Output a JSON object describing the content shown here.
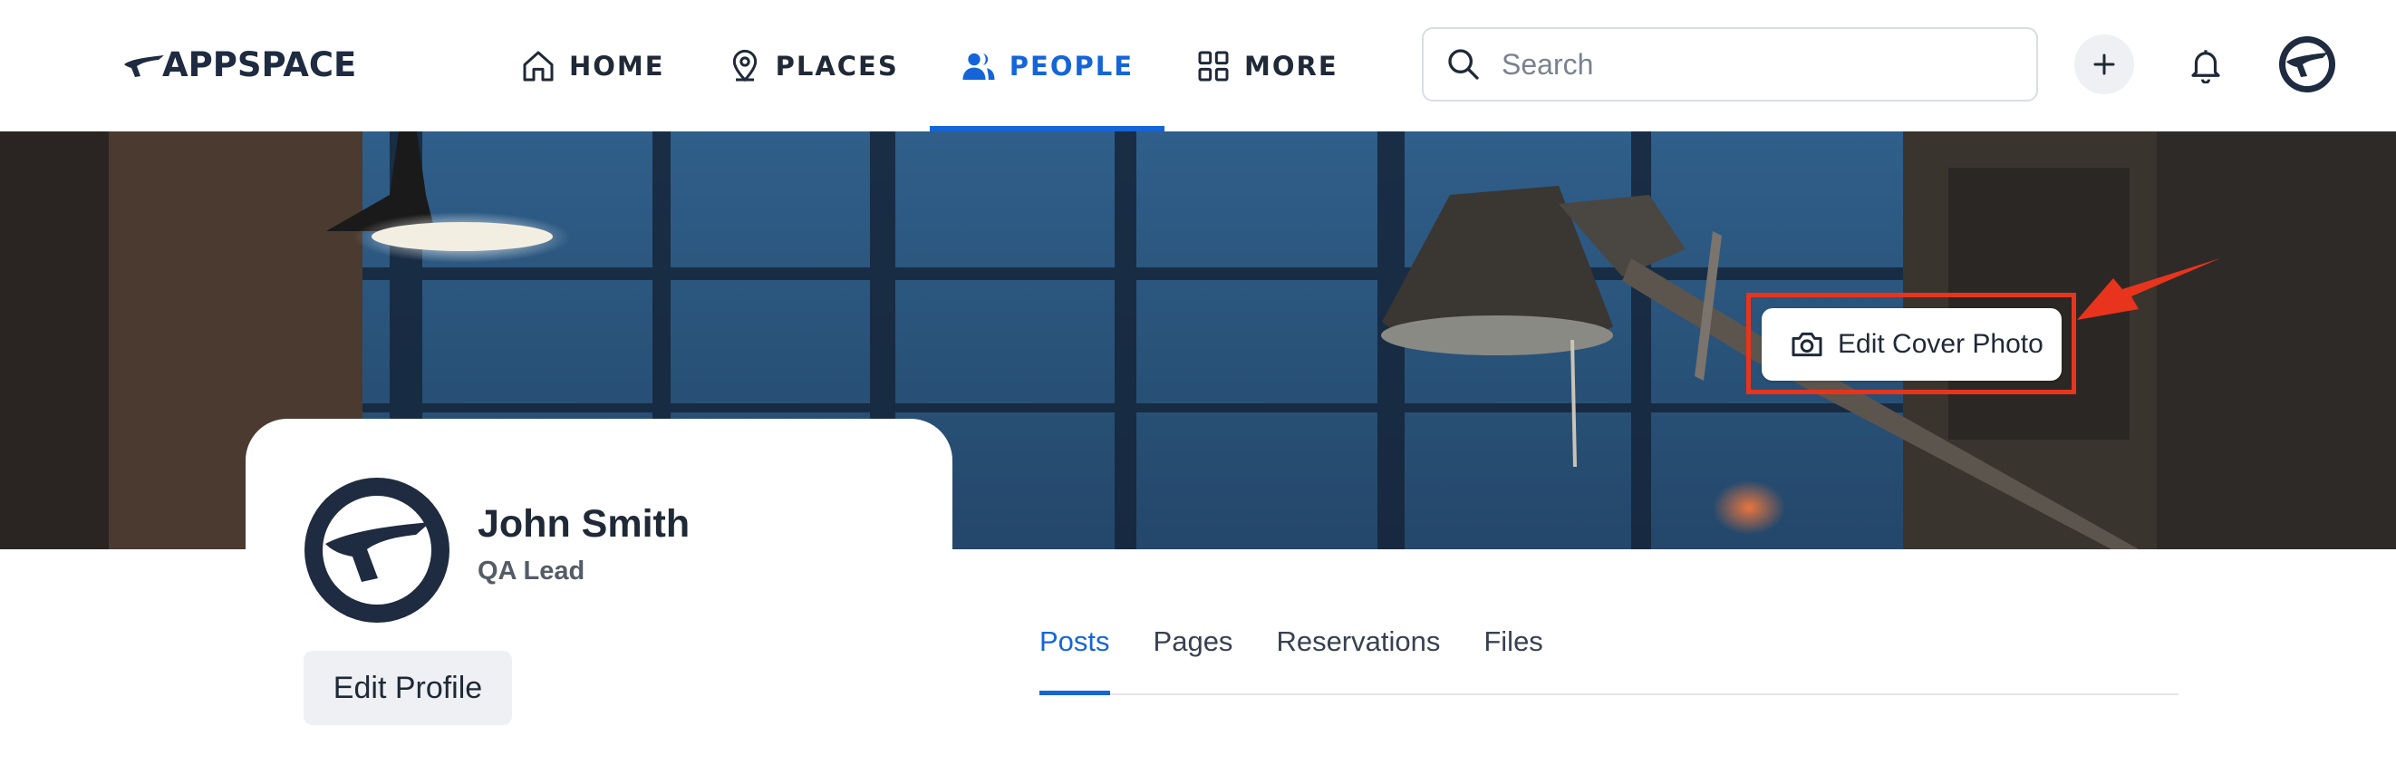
{
  "brand": {
    "name": "APPSPACE",
    "logo_icon": "appspace-swoosh-icon"
  },
  "nav": {
    "items": [
      {
        "label": "HOME",
        "icon": "home-icon",
        "active": false
      },
      {
        "label": "PLACES",
        "icon": "location-pin-icon",
        "active": false
      },
      {
        "label": "PEOPLE",
        "icon": "people-icon",
        "active": true
      },
      {
        "label": "MORE",
        "icon": "grid-icon",
        "active": false
      }
    ]
  },
  "search": {
    "placeholder": "Search",
    "value": ""
  },
  "header_actions": {
    "add_icon": "plus-icon",
    "notifications_icon": "bell-icon",
    "avatar_icon": "user-avatar"
  },
  "cover": {
    "edit_label": "Edit Cover Photo",
    "edit_icon": "camera-icon"
  },
  "profile": {
    "name": "John Smith",
    "role": "QA Lead",
    "edit_label": "Edit Profile"
  },
  "tabs": [
    {
      "label": "Posts",
      "active": true
    },
    {
      "label": "Pages",
      "active": false
    },
    {
      "label": "Reservations",
      "active": false
    },
    {
      "label": "Files",
      "active": false
    }
  ],
  "colors": {
    "accent": "#1565d8",
    "navy": "#1e2b40",
    "highlight": "#e8341c"
  }
}
